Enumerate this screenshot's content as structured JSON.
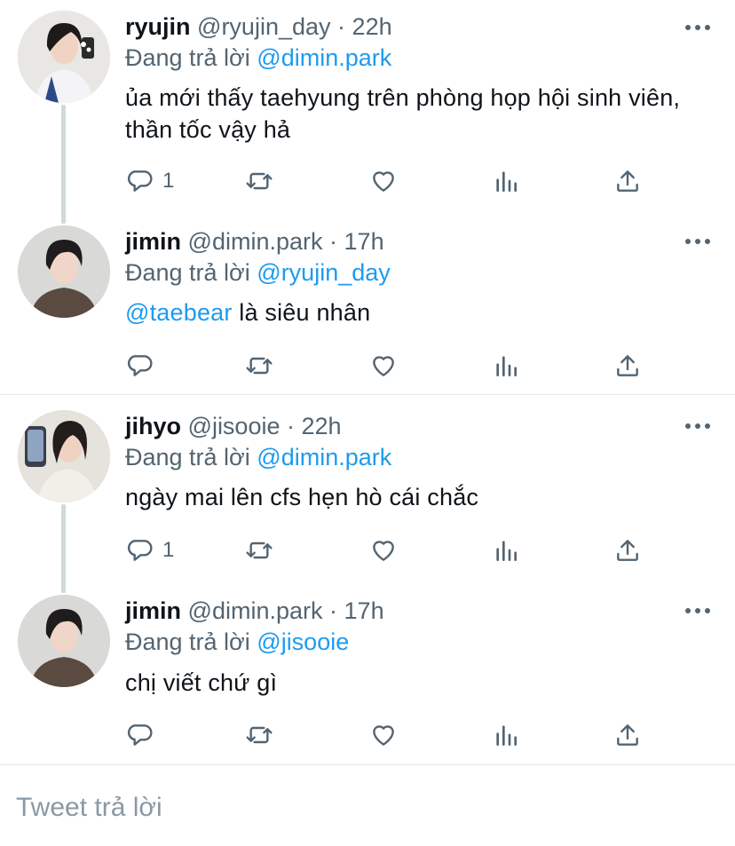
{
  "thread1": {
    "parent": {
      "name": "ryujin",
      "handle": "@ryujin_day",
      "time": "22h",
      "replying_prefix": "Đang trả lời",
      "replying_to": "@dimin.park",
      "text": "ủa mới thấy taehyung trên phòng họp hội sinh viên, thần tốc vậy hả",
      "reply_count": "1"
    },
    "reply": {
      "name": "jimin",
      "handle": "@dimin.park",
      "time": "17h",
      "replying_prefix": "Đang trả lời",
      "replying_to": "@ryujin_day",
      "mention": "@taebear",
      "text": "là siêu nhân",
      "reply_count": ""
    }
  },
  "thread2": {
    "parent": {
      "name": "jihyo",
      "handle": "@jisooie",
      "time": "22h",
      "replying_prefix": "Đang trả lời",
      "replying_to": "@dimin.park",
      "text": "ngày mai lên cfs hẹn hò cái chắc",
      "reply_count": "1"
    },
    "reply": {
      "name": "jimin",
      "handle": "@dimin.park",
      "time": "17h",
      "replying_prefix": "Đang trả lời",
      "replying_to": "@jisooie",
      "text": "chị viết chứ gì",
      "reply_count": ""
    }
  },
  "compose": {
    "placeholder": "Tweet trả lời"
  },
  "icons": [
    "reply-icon",
    "retweet-icon",
    "like-icon",
    "analytics-icon",
    "share-icon",
    "more-icon"
  ],
  "colors": {
    "mention": "#1d9bf0",
    "secondary_text": "#536471",
    "thread_line": "#cfd9de"
  }
}
